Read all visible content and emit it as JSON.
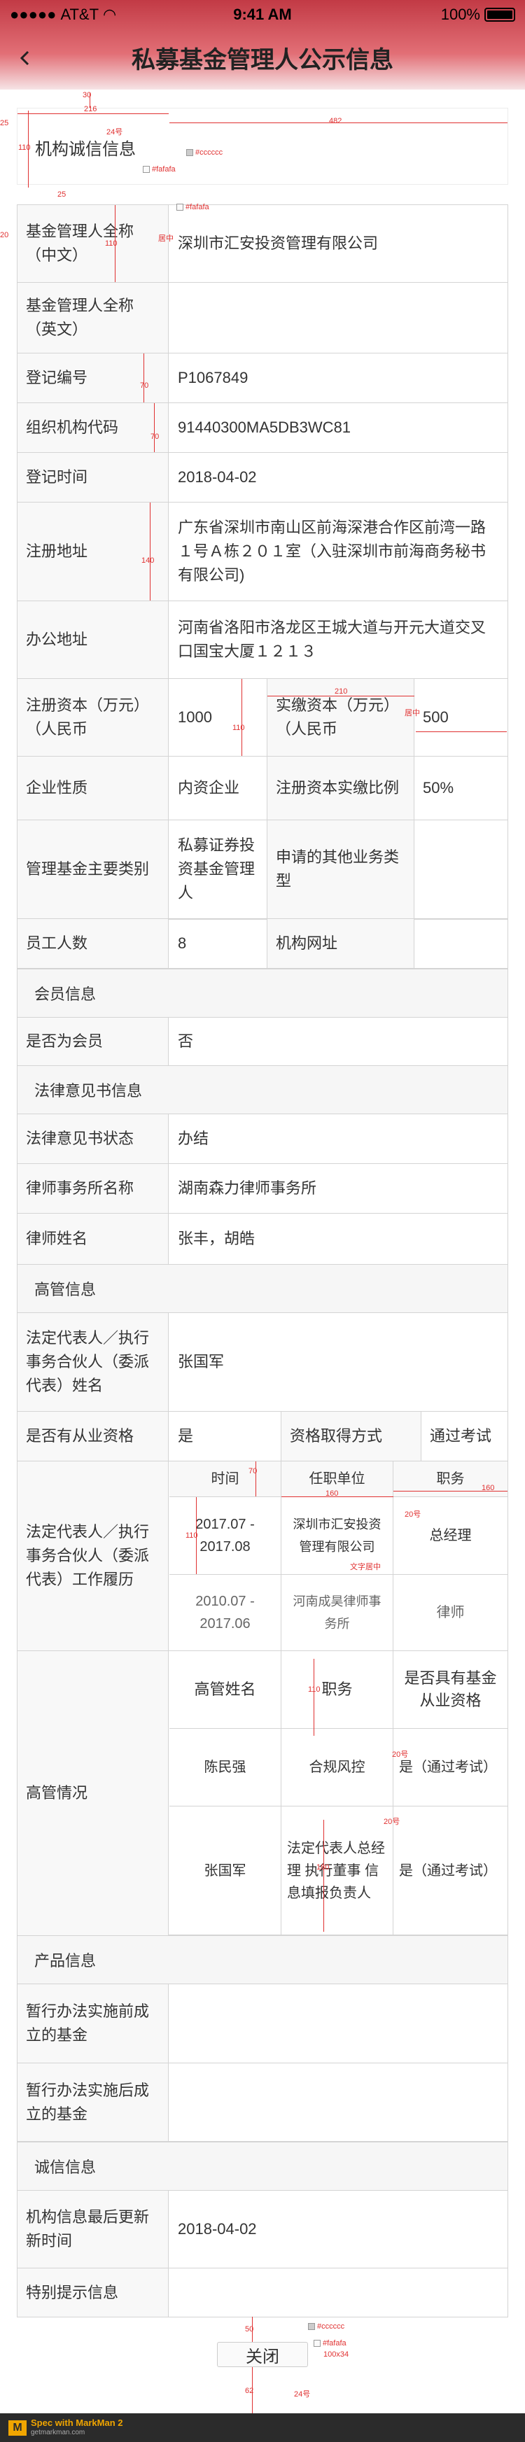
{
  "status": {
    "carrier": "AT&T",
    "time": "9:41 AM",
    "battery": "100%"
  },
  "nav": {
    "title": "私募基金管理人公示信息"
  },
  "section_integrity": {
    "title": "机构诚信信息"
  },
  "basic": {
    "name_cn_label": "基金管理人全称（中文）",
    "name_cn": "深圳市汇安投资管理有限公司",
    "name_en_label": "基金管理人全称（英文）",
    "name_en": "",
    "reg_no_label": "登记编号",
    "reg_no": "P1067849",
    "org_code_label": "组织机构代码",
    "org_code": "91440300MA5DB3WC81",
    "reg_time_label": "登记时间",
    "reg_time": "2018-04-02",
    "reg_addr_label": "注册地址",
    "reg_addr": "广东省深圳市南山区前海深港合作区前湾一路１号Ａ栋２０１室（入驻深圳市前海商务秘书有限公司)",
    "office_label": "办公地址",
    "office": "河南省洛阳市洛龙区王城大道与开元大道交叉口国宝大厦１２１３",
    "capital_label": "注册资本（万元）（人民币",
    "capital": "1000",
    "paid_label": "实缴资本（万元）（人民币",
    "paid": "500",
    "nature_label": "企业性质",
    "nature": "内资企业",
    "ratio_label": "注册资本实缴比例",
    "ratio": "50%",
    "type_label": "管理基金主要类别",
    "type": "私募证券投资基金管理人",
    "other_label": "申请的其他业务类型",
    "other": "",
    "staff_label": "员工人数",
    "staff": "8",
    "website_label": "机构网址",
    "website": ""
  },
  "member": {
    "title": "会员信息",
    "is_member_label": "是否为会员",
    "is_member": "否"
  },
  "legal": {
    "title": "法律意见书信息",
    "status_label": "法律意见书状态",
    "status": "办结",
    "firm_label": "律师事务所名称",
    "firm": "湖南森力律师事务所",
    "lawyer_label": "律师姓名",
    "lawyer": "张丰，胡皓"
  },
  "exec": {
    "title": "高管信息",
    "rep_label": "法定代表人／执行事务合伙人（委派代表）姓名",
    "rep": "张国军",
    "qual_label": "是否有从业资格",
    "qual": "是",
    "qual_way_label": "资格取得方式",
    "qual_way": "通过考试",
    "resume_label": "法定代表人／执行事务合伙人（委派代表）工作履历",
    "resume_headers": [
      "时间",
      "任职单位",
      "职务"
    ],
    "resume": [
      {
        "time": "2017.07 - 2017.08",
        "unit": "深圳市汇安投资管理有限公司",
        "role": "总经理"
      },
      {
        "time": "2010.07 - 2017.06",
        "unit": "河南成昊律师事务所",
        "role": "律师"
      }
    ],
    "mgmt_label": "高管情况",
    "mgmt_headers": [
      "高管姓名",
      "职务",
      "是否具有基金从业资格"
    ],
    "mgmt": [
      {
        "name": "陈民强",
        "role": "合规风控",
        "qual": "是（通过考试）"
      },
      {
        "name": "张国军",
        "role": "法定代表人总经理 执行董事 信息填报负责人",
        "qual": "是（通过考试）"
      }
    ]
  },
  "product": {
    "title": "产品信息",
    "before_label": "暂行办法实施前成立的基金",
    "before": "",
    "after_label": "暂行办法实施后成立的基金",
    "after": ""
  },
  "credit": {
    "title": "诚信信息",
    "update_label": "机构信息最后更新新时间",
    "update": "2018-04-02",
    "special_label": "特别提示信息",
    "special": ""
  },
  "close": "关闭",
  "footer": {
    "brand": "Spec with MarkMan 2",
    "site": "getmarkman.com"
  },
  "annotations": {
    "a30": "30",
    "a24": "24号",
    "a216": "216",
    "a25": "25",
    "a110": "110",
    "a482": "482",
    "ccc": "#cccccc",
    "fafafa": "#fafafa",
    "a20": "20",
    "a70": "70",
    "a140": "140",
    "a210": "210",
    "center": "居中",
    "a160": "160",
    "a62": "62",
    "a50": "50",
    "btn": "100x34",
    "txtcenter": "文字居中",
    "s20": "20号",
    "a180": "180"
  }
}
